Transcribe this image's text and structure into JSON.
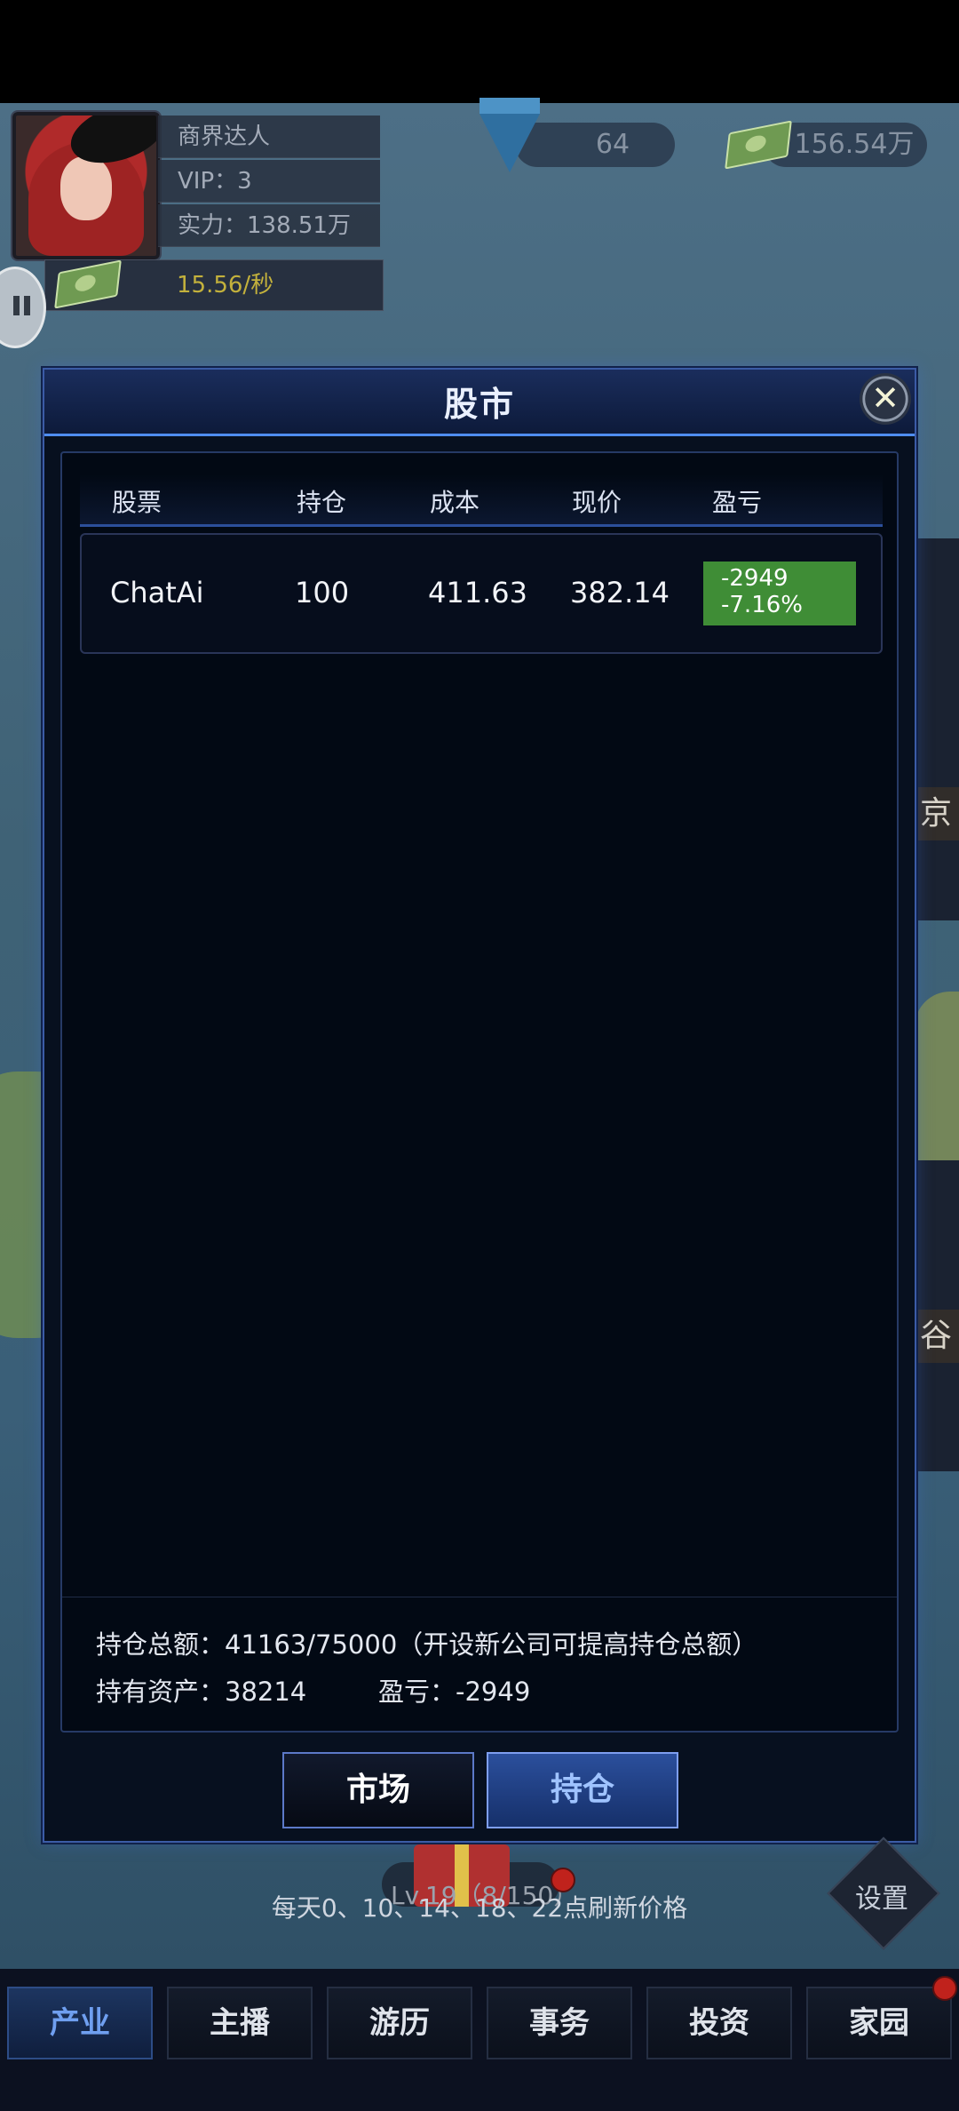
{
  "player": {
    "title": "商界达人",
    "vip": "VIP：3",
    "power": "实力：138.51万",
    "income": "15.56/秒"
  },
  "currency": {
    "diamonds": "64",
    "cash": "156.54万"
  },
  "map_labels": [
    "京",
    "谷"
  ],
  "modal": {
    "title": "股市",
    "table": {
      "headers": [
        "股票",
        "持仓",
        "成本",
        "现价",
        "盈亏"
      ],
      "rows": [
        {
          "name": "ChatAi",
          "holding": "100",
          "cost": "411.63",
          "price": "382.14",
          "pnl_value": "-2949",
          "pnl_percent": "-7.16%"
        }
      ]
    },
    "summary": {
      "total": "持仓总额：41163/75000（开设新公司可提高持仓总额）",
      "assets": "持有资产：38214",
      "pnl": "盈亏：-2949"
    },
    "tabs": {
      "market": "市场",
      "holdings": "持仓",
      "active": "持仓"
    }
  },
  "footer": {
    "level": "Lv.19（8/150）",
    "refresh_note": "每天0、10、14、18、22点刷新价格",
    "settings": "设置"
  },
  "nav": {
    "items": [
      "产业",
      "主播",
      "游历",
      "事务",
      "投资",
      "家园"
    ],
    "active": "产业"
  },
  "colors": {
    "accent_blue": "#4f8df0",
    "pnl_negative_bg": "#3f8d36",
    "income_yellow": "#c3b13c"
  }
}
